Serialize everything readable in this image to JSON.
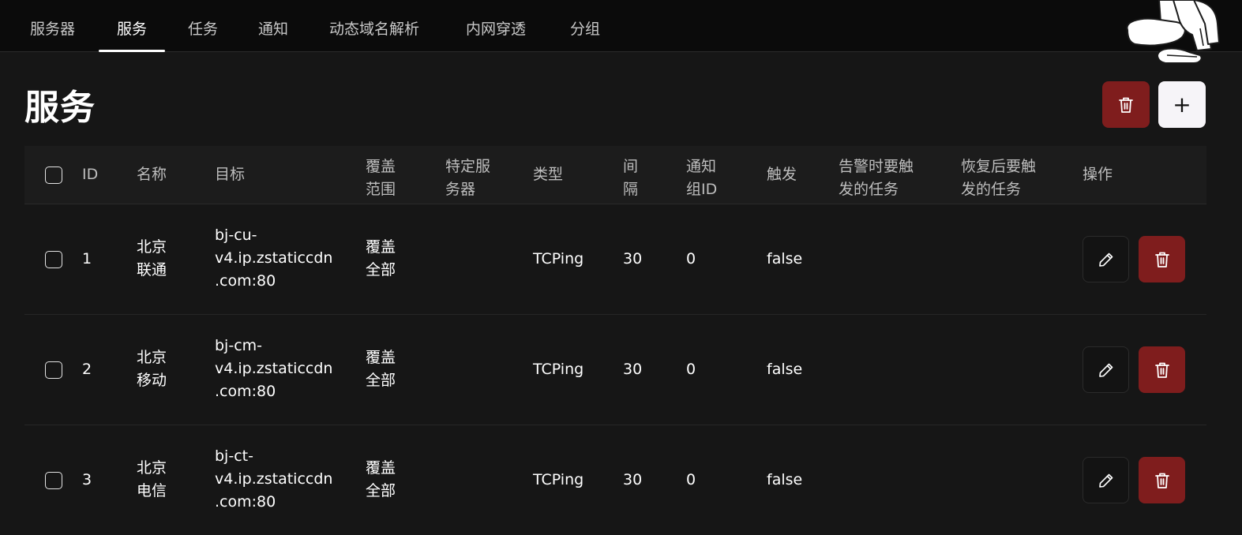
{
  "nav": {
    "tabs": [
      {
        "label": "服务器"
      },
      {
        "label": "服务"
      },
      {
        "label": "任务"
      },
      {
        "label": "通知"
      },
      {
        "label": "动态域名解析"
      },
      {
        "label": "内网穿透"
      },
      {
        "label": "分组"
      }
    ],
    "active_tab": "服务"
  },
  "page": {
    "title": "服务",
    "add_button_label": "+"
  },
  "table": {
    "headers": {
      "id": "ID",
      "name": "名称",
      "target": "目标",
      "cover_1": "覆盖",
      "cover_2": "范围",
      "specific_1": "特定服",
      "specific_2": "务器",
      "type": "类型",
      "interval_1": "间",
      "interval_2": "隔",
      "notify_1": "通知",
      "notify_2": "组ID",
      "trigger": "触发",
      "alert_task_1": "告警时要触",
      "alert_task_2": "发的任务",
      "recover_task_1": "恢复后要触",
      "recover_task_2": "发的任务",
      "actions": "操作"
    },
    "rows": [
      {
        "id": "1",
        "name_1": "北京",
        "name_2": "联通",
        "target_1": "bj-cu-",
        "target_2": "v4.ip.zstaticcdn",
        "target_3": ".com:80",
        "cover_1": "覆盖",
        "cover_2": "全部",
        "type": "TCPing",
        "interval": "30",
        "notify_group": "0",
        "trigger": "false"
      },
      {
        "id": "2",
        "name_1": "北京",
        "name_2": "移动",
        "target_1": "bj-cm-",
        "target_2": "v4.ip.zstaticcdn",
        "target_3": ".com:80",
        "cover_1": "覆盖",
        "cover_2": "全部",
        "type": "TCPing",
        "interval": "30",
        "notify_group": "0",
        "trigger": "false"
      },
      {
        "id": "3",
        "name_1": "北京",
        "name_2": "电信",
        "target_1": "bj-ct-",
        "target_2": "v4.ip.zstaticcdn",
        "target_3": ".com:80",
        "cover_1": "覆盖",
        "cover_2": "全部",
        "type": "TCPing",
        "interval": "30",
        "notify_group": "0",
        "trigger": "false"
      }
    ]
  },
  "colors": {
    "background": "#161616",
    "nav_background": "#0b0b0b",
    "danger": "#7f1d1d",
    "add_button": "#f6f4f8"
  },
  "icons": {
    "delete": "trash-icon",
    "edit": "pencil-icon",
    "add": "plus-icon"
  }
}
